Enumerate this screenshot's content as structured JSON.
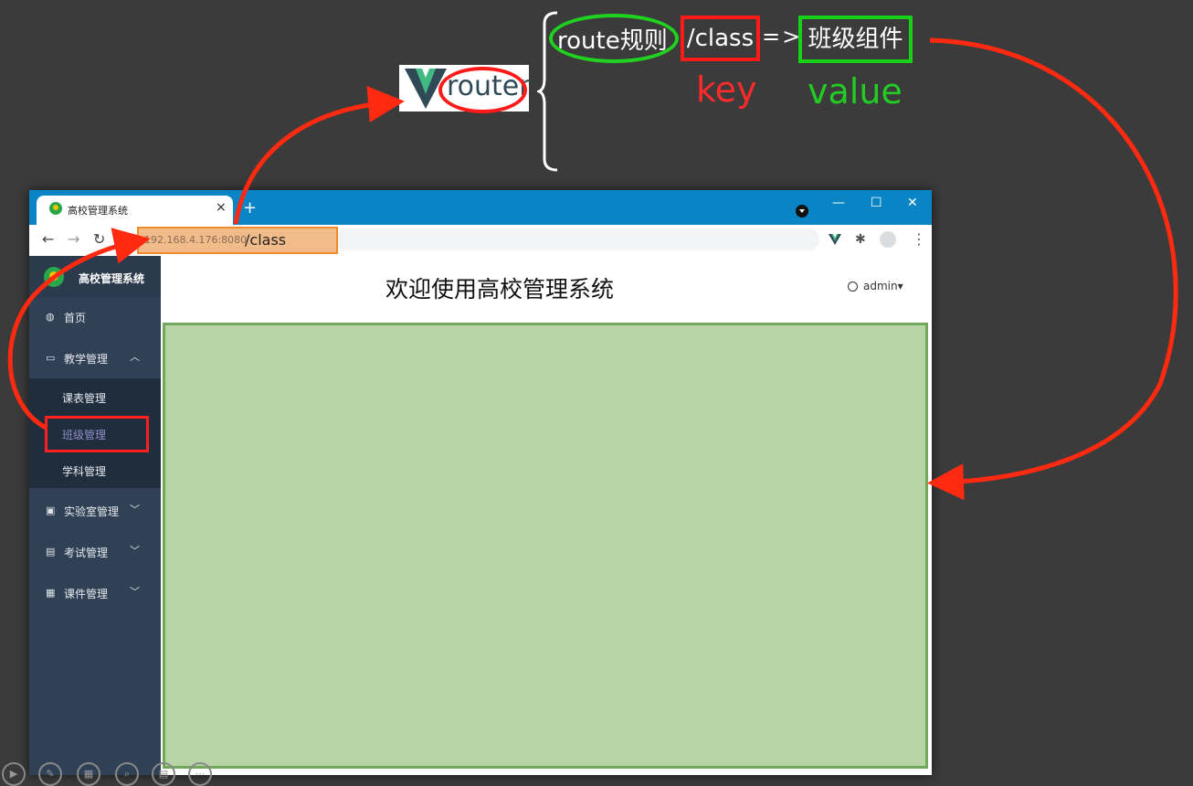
{
  "annotation": {
    "logo_text": "router",
    "rule_label": "route规则",
    "rule_key": "/class",
    "rule_arrow": "=>",
    "rule_value": "班级组件",
    "key_label": "key",
    "value_label": "value",
    "colors": {
      "red": "#ff1a1a",
      "green": "#1fd21f"
    }
  },
  "browser": {
    "tab_title": "高校管理系统",
    "tab_close": "×",
    "new_tab": "+",
    "win_minimize": "—",
    "win_maximize": "☐",
    "win_close": "✕",
    "url_host": "192.168.4.176:8080",
    "url_path": "/class",
    "nav": {
      "back": "←",
      "forward": "→",
      "reload": "↻"
    },
    "toolbar_icons": [
      "vue-devtools-icon",
      "puzzle-icon",
      "profile-icon",
      "menu-icon"
    ]
  },
  "sidebar": {
    "brand": "高校管理系统",
    "items": [
      {
        "label": "首页",
        "icon": "dashboard-icon"
      },
      {
        "label": "教学管理",
        "icon": "monitor-icon",
        "expanded": true,
        "children": [
          "课表管理",
          "班级管理",
          "学科管理"
        ],
        "active_child": "班级管理"
      },
      {
        "label": "实验室管理",
        "icon": "lab-icon"
      },
      {
        "label": "考试管理",
        "icon": "exam-icon"
      },
      {
        "label": "课件管理",
        "icon": "courseware-icon"
      }
    ]
  },
  "header": {
    "welcome": "欢迎使用高校管理系统",
    "user": "admin"
  },
  "content": {
    "bg_color": "#b7d4a7"
  }
}
